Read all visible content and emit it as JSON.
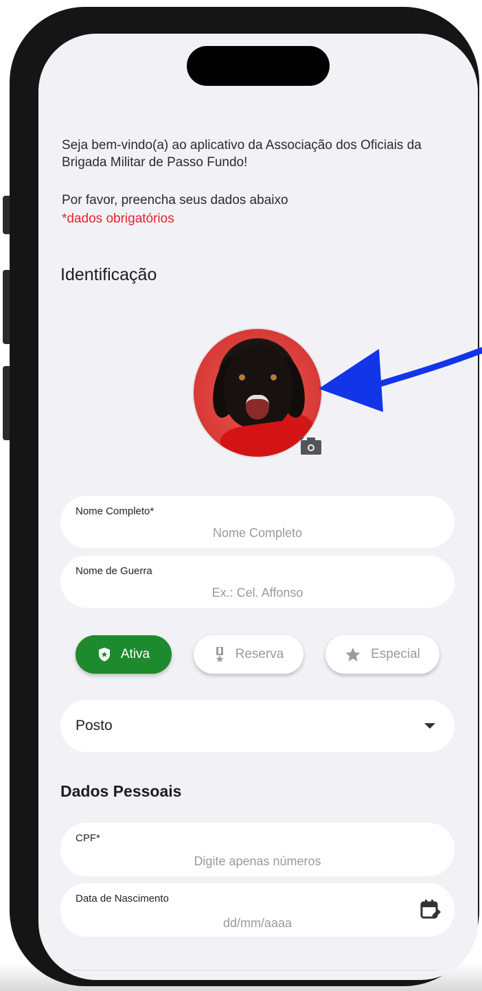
{
  "intro": {
    "welcome": "Seja bem-vindo(a) ao aplicativo da Associação dos Oficiais da Brigada Militar de Passo Fundo!",
    "instruction": "Por favor, preencha seus dados abaixo",
    "required_note": "*dados obrigatórios"
  },
  "identificacao": {
    "title": "Identificação",
    "avatar_icon": "camera-icon",
    "nome_completo": {
      "label": "Nome Completo*",
      "placeholder": "Nome Completo"
    },
    "nome_guerra": {
      "label": "Nome de Guerra",
      "placeholder": "Ex.: Cel. Affonso"
    },
    "status_options": [
      {
        "label": "Ativa",
        "icon": "shield-star-icon",
        "selected": true
      },
      {
        "label": "Reserva",
        "icon": "medal-icon",
        "selected": false
      },
      {
        "label": "Especial",
        "icon": "star-icon",
        "selected": false
      }
    ],
    "posto": {
      "value": "Posto"
    }
  },
  "dados_pessoais": {
    "title": "Dados Pessoais",
    "cpf": {
      "label": "CPF*",
      "placeholder": "Digite apenas números"
    },
    "nascimento": {
      "label": "Data de Nascimento",
      "placeholder": "dd/mm/aaaa",
      "icon": "calendar-edit-icon"
    }
  },
  "colors": {
    "active_chip": "#1d8a2e",
    "required_text": "#e8212b",
    "annotation_arrow": "#1335e8"
  }
}
